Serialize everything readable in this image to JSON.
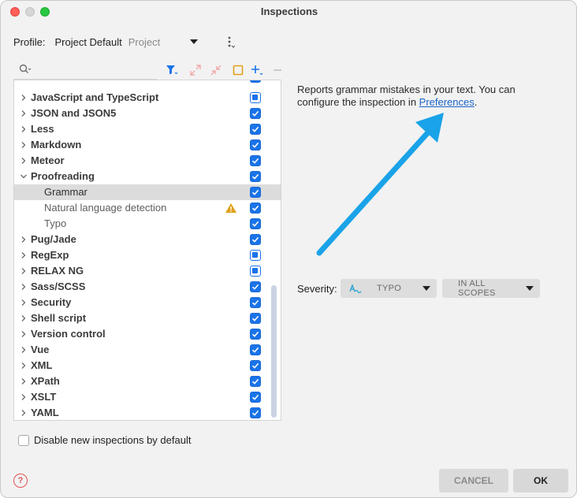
{
  "window": {
    "title": "Inspections"
  },
  "profile": {
    "label": "Profile:",
    "name": "Project Default",
    "scope": "Project"
  },
  "search": {
    "placeholder": ""
  },
  "tree": {
    "rows": [
      {
        "label": "JavaScript and TypeScript",
        "kind": "group",
        "state": "partial",
        "expanded": false
      },
      {
        "label": "JSON and JSON5",
        "kind": "group",
        "state": "checked",
        "expanded": false
      },
      {
        "label": "Less",
        "kind": "group",
        "state": "checked",
        "expanded": false
      },
      {
        "label": "Markdown",
        "kind": "group",
        "state": "checked",
        "expanded": false
      },
      {
        "label": "Meteor",
        "kind": "group",
        "state": "checked",
        "expanded": false
      },
      {
        "label": "Proofreading",
        "kind": "group",
        "state": "checked",
        "expanded": true
      },
      {
        "label": "Grammar",
        "kind": "child",
        "state": "checked",
        "selected": true
      },
      {
        "label": "Natural language detection",
        "kind": "child",
        "state": "checked",
        "warning": true
      },
      {
        "label": "Typo",
        "kind": "child",
        "state": "checked"
      },
      {
        "label": "Pug/Jade",
        "kind": "group",
        "state": "checked",
        "expanded": false
      },
      {
        "label": "RegExp",
        "kind": "group",
        "state": "partial",
        "expanded": false
      },
      {
        "label": "RELAX NG",
        "kind": "group",
        "state": "partial",
        "expanded": false
      },
      {
        "label": "Sass/SCSS",
        "kind": "group",
        "state": "checked",
        "expanded": false
      },
      {
        "label": "Security",
        "kind": "group",
        "state": "checked",
        "expanded": false
      },
      {
        "label": "Shell script",
        "kind": "group",
        "state": "checked",
        "expanded": false
      },
      {
        "label": "Version control",
        "kind": "group",
        "state": "checked",
        "expanded": false
      },
      {
        "label": "Vue",
        "kind": "group",
        "state": "checked",
        "expanded": false
      },
      {
        "label": "XML",
        "kind": "group",
        "state": "checked",
        "expanded": false
      },
      {
        "label": "XPath",
        "kind": "group",
        "state": "checked",
        "expanded": false
      },
      {
        "label": "XSLT",
        "kind": "group",
        "state": "checked",
        "expanded": false
      },
      {
        "label": "YAML",
        "kind": "group",
        "state": "checked",
        "expanded": false
      }
    ]
  },
  "description": {
    "text_before": "Reports grammar mistakes in your text. You can configure the inspection in ",
    "link": "Preferences",
    "text_after": "."
  },
  "severity": {
    "label": "Severity:",
    "value": "TYPO",
    "scope": "IN ALL SCOPES"
  },
  "options": {
    "disable_new_label": "Disable new inspections by default"
  },
  "buttons": {
    "cancel": "CANCEL",
    "ok": "OK",
    "help": "?"
  },
  "colors": {
    "accent": "#1a73e8",
    "annotation_arrow": "#1aa3e8",
    "warning": "#e0a018",
    "link": "#1a64c9"
  }
}
